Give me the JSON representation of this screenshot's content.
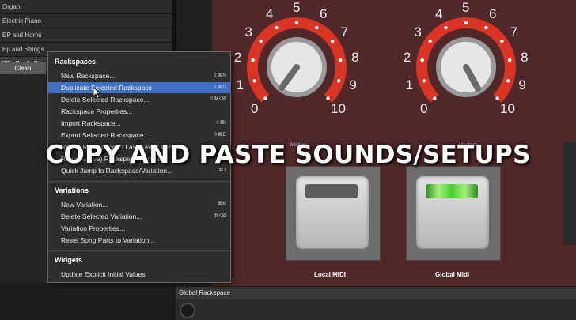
{
  "rackspaces": {
    "items": [
      {
        "label": "Organ"
      },
      {
        "label": "Electric Piano"
      },
      {
        "label": "EP and Horns"
      },
      {
        "label": "Ep and Strings"
      },
      {
        "label": "80's Synth Str"
      }
    ],
    "selected_variation": "Clean"
  },
  "context_menu": {
    "sections": [
      {
        "title": "Rackspaces",
        "items": [
          {
            "label": "New Rackspace...",
            "shortcut": "⇧⌘N"
          },
          {
            "label": "Duplicate Selected Rackspace",
            "shortcut": "⇧⌘D",
            "highlighted": true
          },
          {
            "label": "Delete Selected Rackspace...",
            "shortcut": "⇧⌘⌫"
          },
          {
            "label": "Rackspace Properties...",
            "shortcut": ""
          },
          {
            "label": "Import Rackspace...",
            "shortcut": "⇧⌘I"
          },
          {
            "label": "Export Selected Rackspace...",
            "shortcut": "⇧⌘E"
          },
          {
            "label": "Revert Rackspace to Last Saved Version",
            "shortcut": ""
          },
          {
            "label": "Remove (live) Rackspace from file",
            "shortcut": ""
          },
          {
            "label": "Quick Jump to Rackspace/Variation...",
            "shortcut": "⌘J"
          }
        ]
      },
      {
        "title": "Variations",
        "items": [
          {
            "label": "New Variation...",
            "shortcut": "⌘N"
          },
          {
            "label": "Delete Selected Variation...",
            "shortcut": "⌘⌫"
          },
          {
            "label": "Variation Properties...",
            "shortcut": ""
          },
          {
            "label": "Reset Song Parts to Variation...",
            "shortcut": ""
          }
        ]
      },
      {
        "title": "Widgets",
        "items": [
          {
            "label": "Update Explicit Initial Values",
            "shortcut": ""
          }
        ]
      }
    ]
  },
  "knobs": [
    {
      "caption": "MinNote",
      "scale": [
        "0",
        "1",
        "2",
        "3",
        "4",
        "5",
        "6",
        "7",
        "8",
        "9",
        "10"
      ],
      "value": 0.05
    },
    {
      "caption": "MaxNote",
      "scale": [
        "0",
        "1",
        "2",
        "3",
        "4",
        "5",
        "6",
        "7",
        "8",
        "9",
        "10"
      ],
      "value": 0.2
    }
  ],
  "pads": [
    {
      "label": "Local MIDI",
      "on": false
    },
    {
      "label": "Global Midi",
      "on": true
    }
  ],
  "bottom_panel": {
    "title": "Global Rackspace"
  },
  "overlay": {
    "caption": "COPY AND PASTE SOUNDS/SETUPS"
  },
  "colors": {
    "canvas": "#51282a",
    "knob_ring": "#d93424",
    "highlight": "#3f6fc2",
    "led_on": "#6de04c"
  }
}
